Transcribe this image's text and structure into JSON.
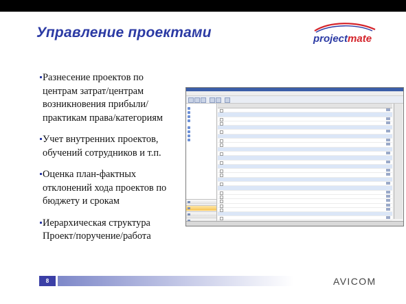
{
  "slide": {
    "title": "Управление проектами",
    "page_number": "8",
    "footer_brand": "AVICOM"
  },
  "logo": {
    "text_main": "project",
    "text_accent": "mate"
  },
  "bullets": [
    "Разнесение проектов по центрам затрат/центрам возникновения прибыли/практикам права/категориям",
    "Учет внутренних проектов, обучений сотрудников и т.п.",
    "Оценка план-фактных отклонений хода проектов по бюджету и срокам",
    "Иерархическая структура Проект/поручение/работа"
  ],
  "colors": {
    "title": "#2b3aa4",
    "footer_num_bg": "#3b3fa6",
    "top_bar": "#000000"
  }
}
